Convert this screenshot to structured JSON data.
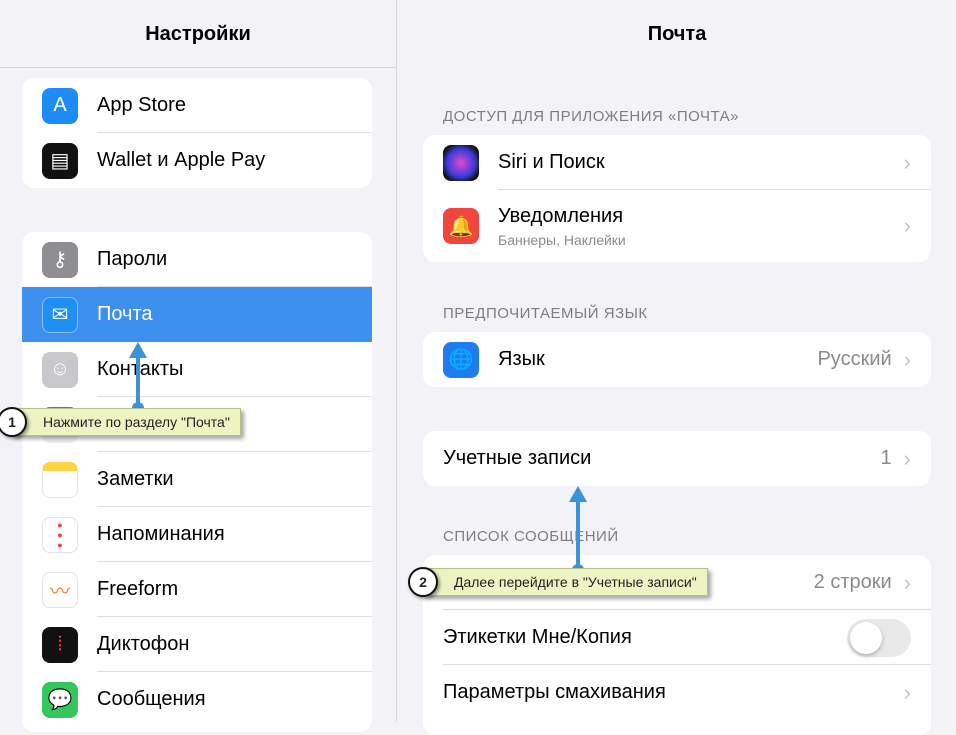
{
  "left": {
    "title": "Настройки",
    "group1": [
      {
        "label": "App Store",
        "icon": "app-store-icon",
        "color": "#1d8cf5"
      },
      {
        "label": "Wallet и Apple Pay",
        "icon": "wallet-icon",
        "color": "#111111"
      }
    ],
    "group2": [
      {
        "label": "Пароли",
        "icon": "key-icon",
        "color": "#8e8e93"
      },
      {
        "label": "Почта",
        "icon": "mail-icon",
        "color": "#1f8ef5",
        "selected": true
      },
      {
        "label": "Контакты",
        "icon": "contacts-icon",
        "color": "#c8c8cc"
      },
      {
        "label": "",
        "icon": "calendar-icon",
        "color": "#f0f0f0"
      },
      {
        "label": "Заметки",
        "icon": "notes-icon",
        "color": "#fbd343"
      },
      {
        "label": "Напоминания",
        "icon": "reminders-icon",
        "color": "#ffffff"
      },
      {
        "label": "Freeform",
        "icon": "freeform-icon",
        "color": "#ffffff"
      },
      {
        "label": "Диктофон",
        "icon": "voice-memos-icon",
        "color": "#111111"
      },
      {
        "label": "Сообщения",
        "icon": "messages-icon",
        "color": "#34c759"
      }
    ]
  },
  "right": {
    "title": "Почта",
    "section1": "ДОСТУП ДЛЯ ПРИЛОЖЕНИЯ «ПОЧТА»",
    "siri": "Siri и Поиск",
    "notifications": "Уведомления",
    "notifications_sub": "Баннеры, Наклейки",
    "section2": "ПРЕДПОЧИТАЕМЫЙ ЯЗЫК",
    "language": "Язык",
    "language_value": "Русский",
    "accounts": "Учетные записи",
    "accounts_value": "1",
    "section3": "СПИСОК СООБЩЕНИЙ",
    "preview_value": "2 строки",
    "labels": "Этикетки Мне/Копия",
    "labels_toggle": false,
    "swipe": "Параметры смахивания"
  },
  "callouts": [
    {
      "num": "1",
      "text": "Нажмите по разделу \"Почта\""
    },
    {
      "num": "2",
      "text": "Далее перейдите в \"Учетные записи\""
    }
  ],
  "accent": "#3d8ff0"
}
